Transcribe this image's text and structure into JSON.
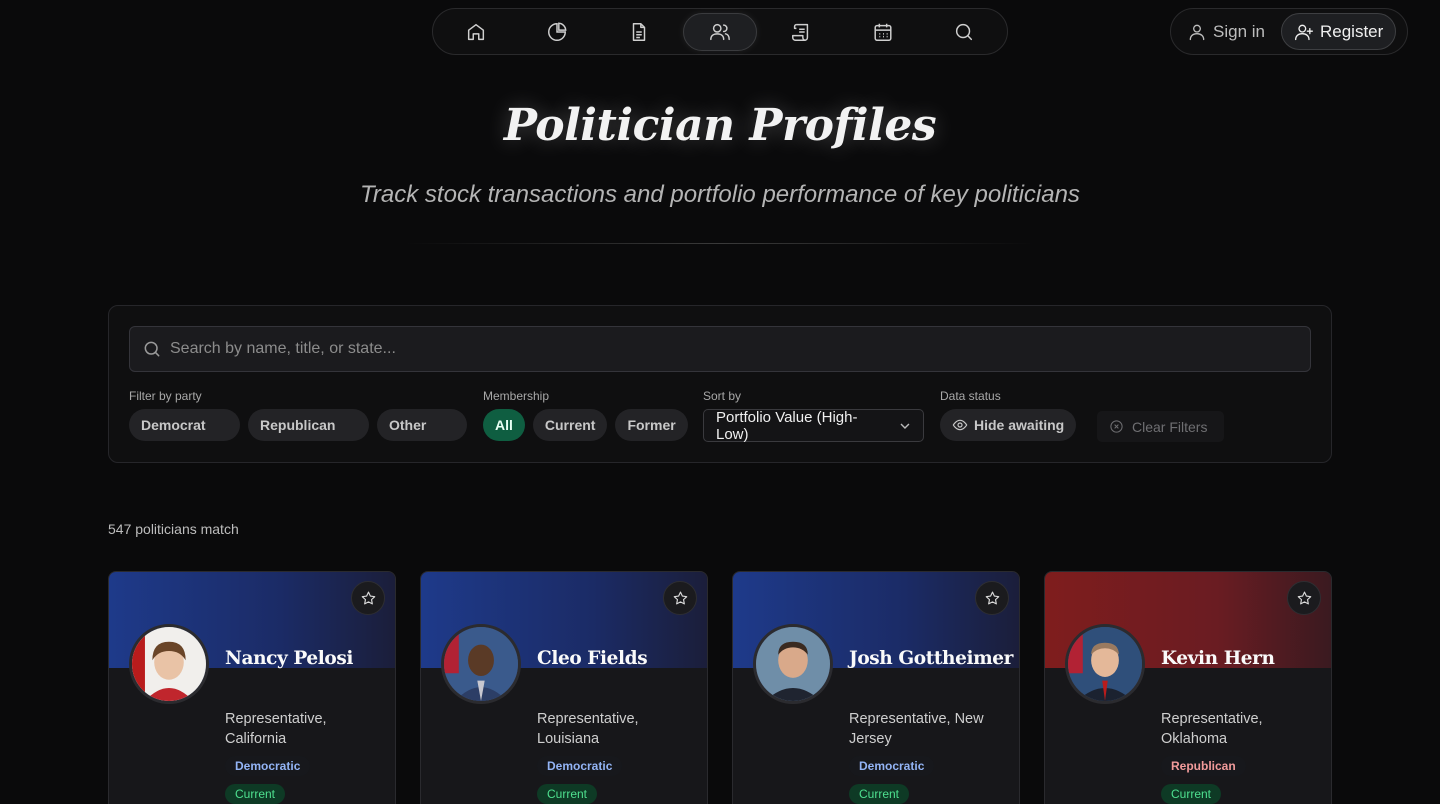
{
  "nav": {
    "items": [
      {
        "name": "home-icon"
      },
      {
        "name": "pie-chart-icon"
      },
      {
        "name": "document-icon"
      },
      {
        "name": "users-icon",
        "active": true
      },
      {
        "name": "scroll-icon"
      },
      {
        "name": "calendar-icon"
      },
      {
        "name": "search-icon"
      }
    ]
  },
  "auth": {
    "sign_in": "Sign in",
    "register": "Register"
  },
  "hero": {
    "title": "Politician Profiles",
    "subtitle": "Track stock transactions and portfolio performance of key politicians"
  },
  "filters": {
    "search_placeholder": "Search by name, title, or state...",
    "party_label": "Filter by party",
    "party_options": [
      "Democrat",
      "Republican",
      "Other"
    ],
    "membership_label": "Membership",
    "membership_options": [
      "All",
      "Current",
      "Former"
    ],
    "membership_selected": "All",
    "sort_label": "Sort by",
    "sort_value": "Portfolio Value (High-Low)",
    "data_status_label": "Data status",
    "hide_awaiting": "Hide awaiting",
    "clear": "Clear Filters"
  },
  "results": {
    "count_text": "547 politicians match"
  },
  "cards": [
    {
      "name": "Nancy Pelosi",
      "role": "Representative, California",
      "party": "Democratic",
      "status": "Current"
    },
    {
      "name": "Cleo Fields",
      "role": "Representative, Louisiana",
      "party": "Democratic",
      "status": "Current"
    },
    {
      "name": "Josh Gottheimer",
      "role": "Representative, New Jersey",
      "party": "Democratic",
      "status": "Current"
    },
    {
      "name": "Kevin Hern",
      "role": "Representative, Oklahoma",
      "party": "Republican",
      "status": "Current"
    }
  ],
  "colors": {
    "accent": "#0f5e41",
    "democratic": "#1e3a8a",
    "republican": "#7f1d1d",
    "current": "#4ee08f"
  }
}
